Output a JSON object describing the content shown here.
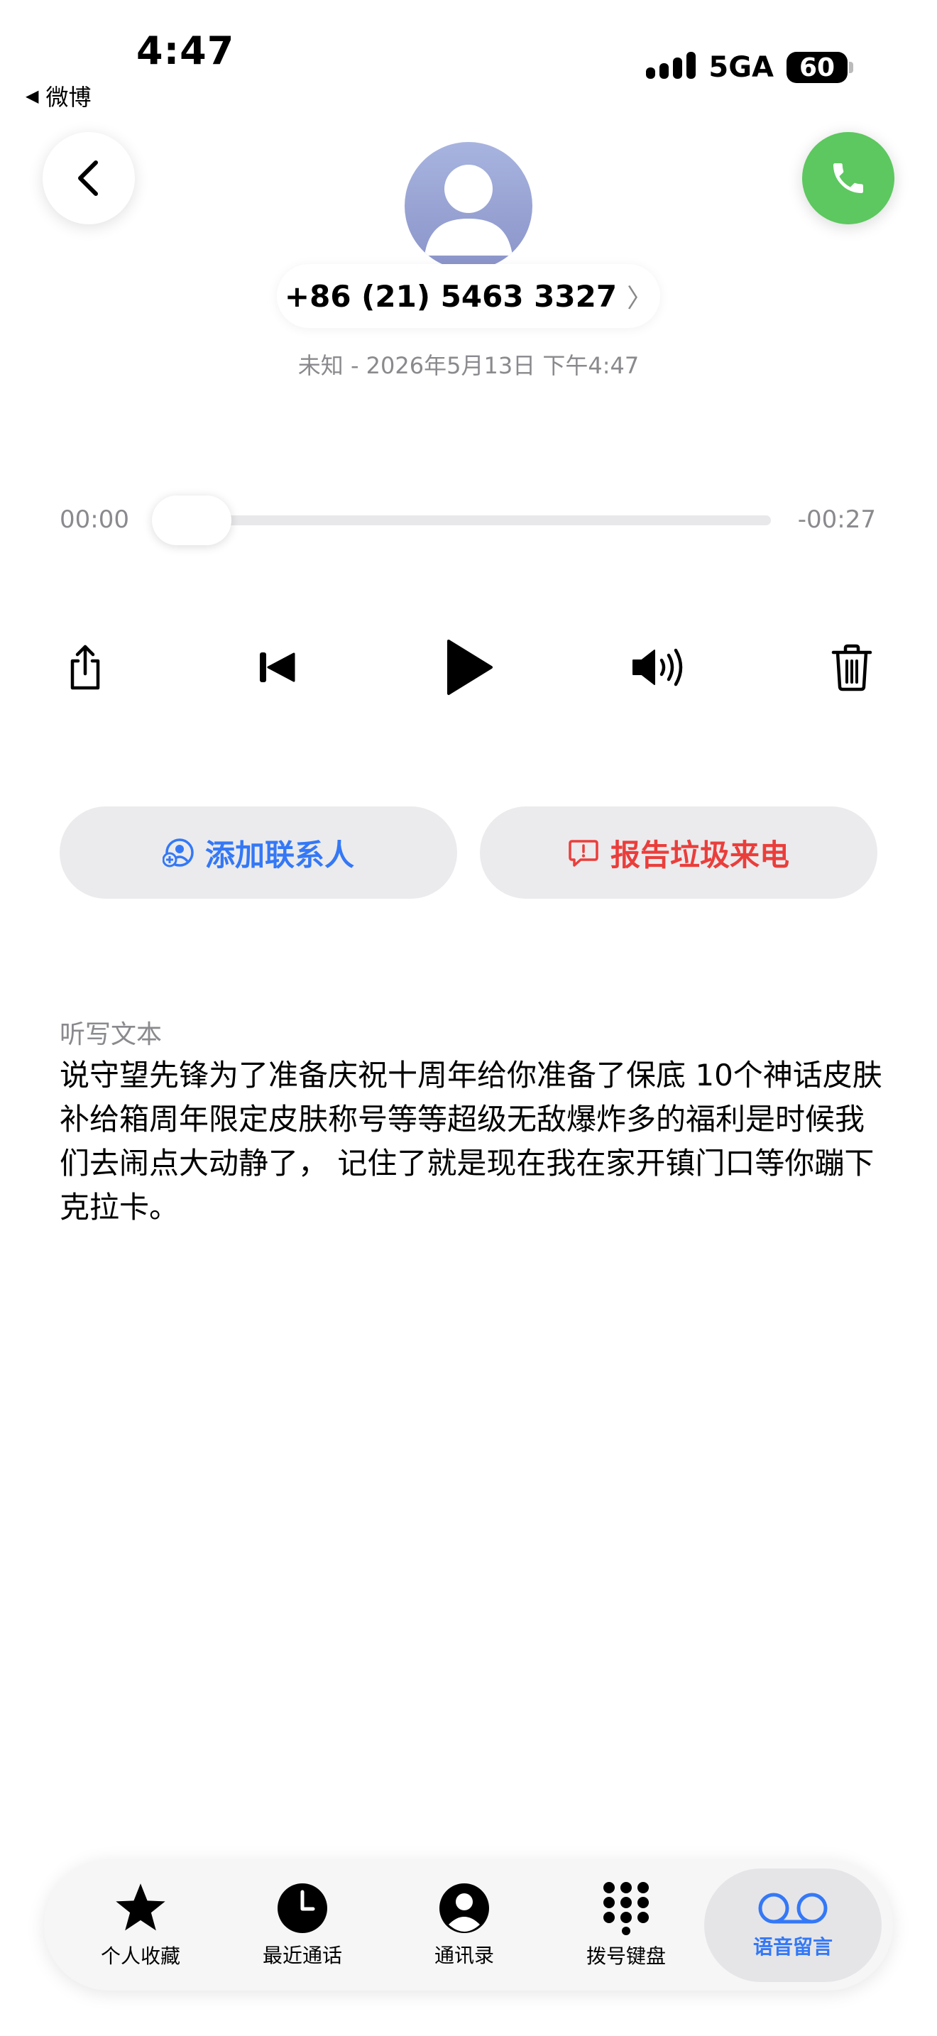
{
  "status_bar": {
    "time": "4:47",
    "back_app": "微博",
    "network": "5GA",
    "battery": "60"
  },
  "contact": {
    "number": "+86 (21) 5463 3327",
    "chevron": "〉",
    "meta": "未知 - 2026年5月13日 下午4:47"
  },
  "player": {
    "elapsed": "00:00",
    "remaining": "-00:27",
    "progress": 0
  },
  "actions": {
    "add_contact": "添加联系人",
    "report_spam": "报告垃圾来电"
  },
  "transcript": {
    "label": "听写文本",
    "text": "说守望先锋为了准备庆祝十周年给你准备了保底 10个神话皮肤补给箱周年限定皮肤称号等等超级无敌爆炸多的福利是时候我们去闹点大动静了， 记住了就是现在我在家开镇门口等你蹦下克拉卡。"
  },
  "tabs": [
    {
      "label": "个人收藏",
      "icon": "star-icon"
    },
    {
      "label": "最近通话",
      "icon": "clock-icon"
    },
    {
      "label": "通讯录",
      "icon": "person-circle-icon"
    },
    {
      "label": "拨号键盘",
      "icon": "keypad-icon"
    },
    {
      "label": "语音留言",
      "icon": "voicemail-icon",
      "selected": true
    }
  ],
  "colors": {
    "accent_blue": "#3478f6",
    "report_red": "#ea3e3b",
    "call_green": "#5cc85f"
  }
}
